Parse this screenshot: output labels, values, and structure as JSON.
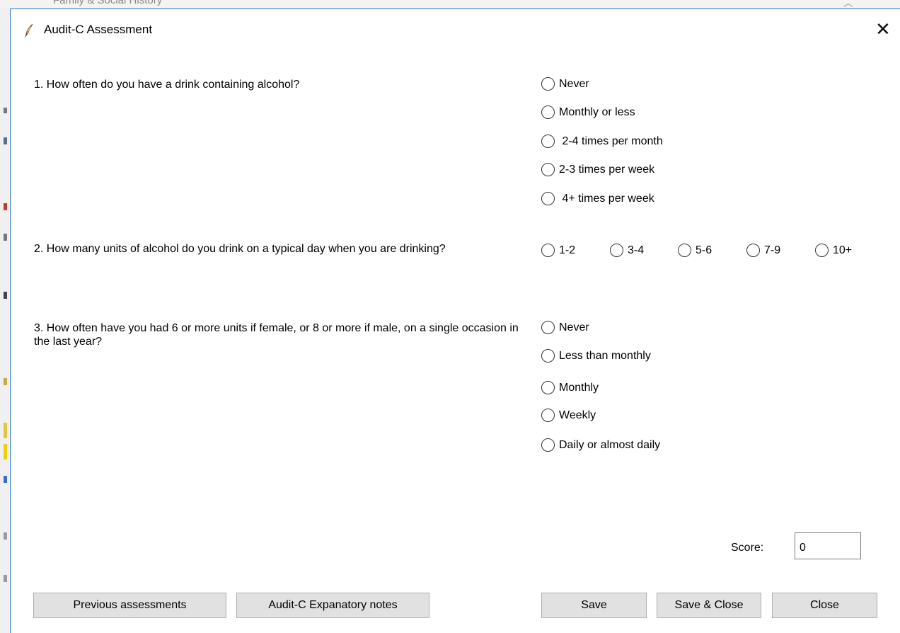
{
  "background_window": {
    "title": "Family & Social History"
  },
  "dialog": {
    "title": "Audit-C Assessment",
    "close_glyph": "✕"
  },
  "questions": [
    {
      "text": "1. How often do you have a drink containing alcohol?",
      "options": [
        "Never",
        "Monthly or less",
        " 2-4 times per month",
        "2-3 times per week",
        " 4+ times per week"
      ]
    },
    {
      "text": "2. How many units of alcohol do you drink on a typical day when you are drinking?",
      "options": [
        "1-2",
        "3-4",
        "5-6",
        "7-9",
        "10+"
      ]
    },
    {
      "text": "3. How often have you had 6 or more units if female, or 8 or more if male, on a single occasion in the last year?",
      "options": [
        "Never",
        "Less than monthly",
        "Monthly",
        "Weekly",
        "Daily or almost daily"
      ]
    }
  ],
  "score": {
    "label": "Score:",
    "value": "0"
  },
  "buttons": {
    "previous": "Previous assessments",
    "notes": "Audit-C Expanatory notes",
    "save": "Save",
    "save_close": "Save & Close",
    "close": "Close"
  },
  "colors": {
    "window_border": "#2b78c4",
    "button_face": "#e1e1e1",
    "button_border": "#adadad"
  },
  "icons": {
    "app": "feather-pen-icon",
    "close": "close-icon",
    "radio": "radio-circle"
  }
}
